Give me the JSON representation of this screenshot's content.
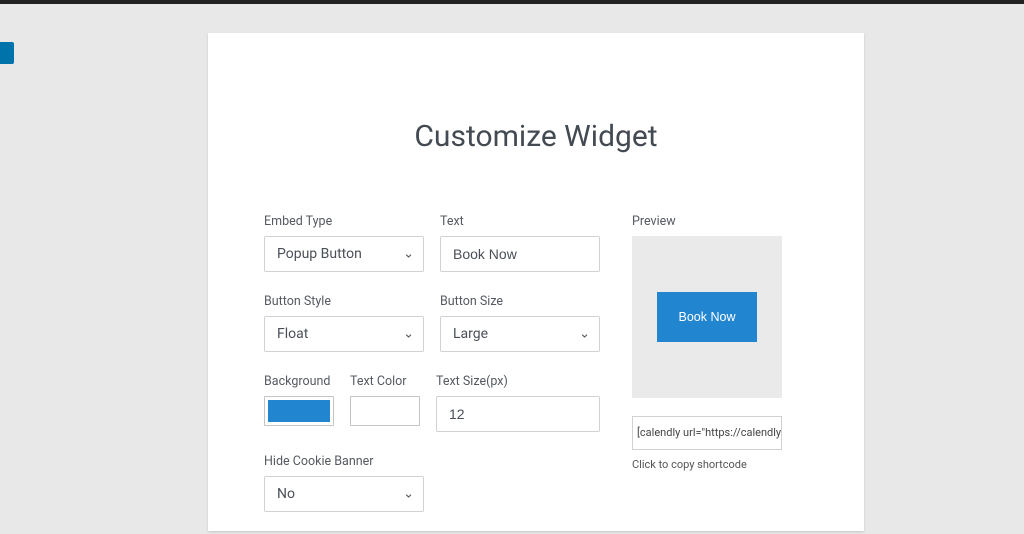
{
  "title": "Customize Widget",
  "fields": {
    "embedType": {
      "label": "Embed Type",
      "value": "Popup Button"
    },
    "text": {
      "label": "Text",
      "value": "Book Now"
    },
    "buttonStyle": {
      "label": "Button Style",
      "value": "Float"
    },
    "buttonSize": {
      "label": "Button Size",
      "value": "Large"
    },
    "background": {
      "label": "Background",
      "color": "#2285d0"
    },
    "textColor": {
      "label": "Text Color",
      "color": "#ffffff"
    },
    "textSize": {
      "label": "Text Size(px)",
      "value": "12"
    },
    "hideCookie": {
      "label": "Hide Cookie Banner",
      "value": "No"
    }
  },
  "preview": {
    "label": "Preview",
    "buttonText": "Book Now",
    "shortcode": "[calendly url=\"https://calendly",
    "hint": "Click to copy shortcode"
  }
}
